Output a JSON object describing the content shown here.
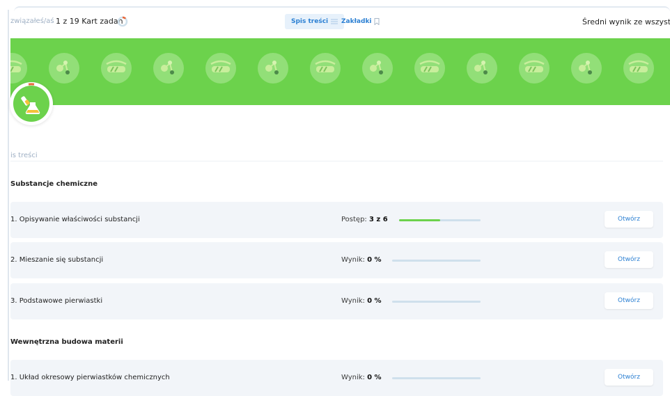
{
  "header": {
    "breadcrumb_fragment": "związałeś/aś",
    "cards_count": "1 z 19 Kart zadań",
    "tab_toc": "Spis treści",
    "tab_bookmarks": "Zakładki",
    "average_score": "Średni wynik ze wszystkich"
  },
  "toc": {
    "heading": "is treści"
  },
  "sections": [
    {
      "title": "Substancje chemiczne",
      "items": [
        {
          "name": "1. Opisywanie właściwości substancji",
          "metric_label": "Postęp:",
          "metric_value": "3 z 6",
          "progress": 0.5,
          "button": "Otwórz"
        },
        {
          "name": "2. Mieszanie się substancji",
          "metric_label": "Wynik:",
          "metric_value": "0 %",
          "progress": 0,
          "button": "Otwórz"
        },
        {
          "name": "3. Podstawowe pierwiastki",
          "metric_label": "Wynik:",
          "metric_value": "0 %",
          "progress": 0,
          "button": "Otwórz"
        }
      ]
    },
    {
      "title": "Wewnętrzna budowa materii",
      "items": [
        {
          "name": "1. Układ okresowy pierwiastków chemicznych",
          "metric_label": "Wynik:",
          "metric_value": "0 %",
          "progress": 0,
          "button": "Otwórz"
        }
      ]
    }
  ],
  "colors": {
    "accent_green": "#6cd24c",
    "link_blue": "#2c80d3",
    "progress_orange": "#e8683a",
    "track_blue": "#cfe0ec"
  },
  "icons": [
    "cards-progress-ring-icon",
    "list-icon",
    "bookmark-icon",
    "goggles-icon",
    "molecule-icon",
    "flask-icon"
  ]
}
